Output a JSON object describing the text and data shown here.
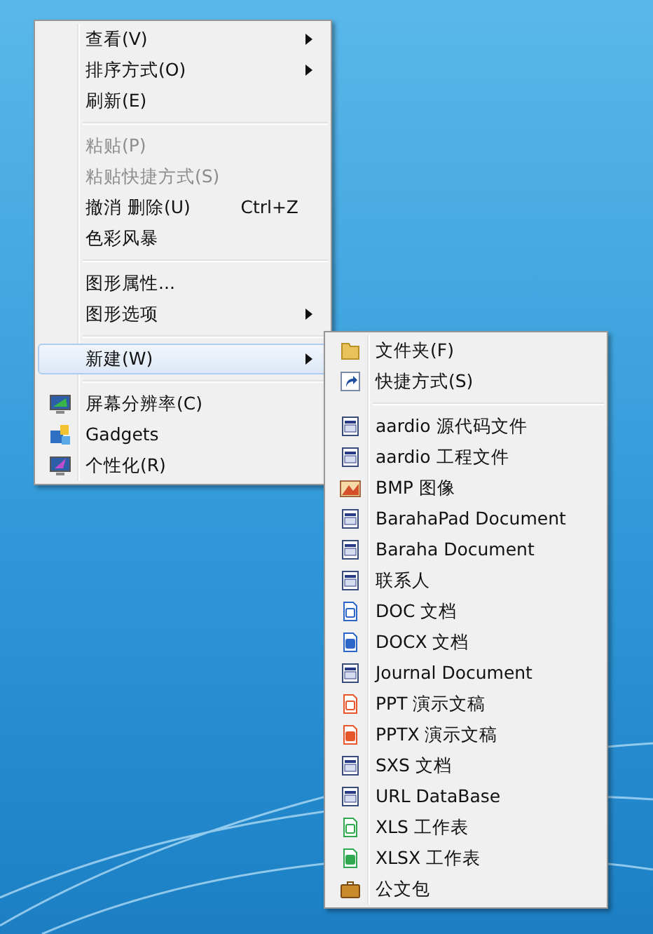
{
  "context_menu": {
    "items": [
      {
        "kind": "submenu",
        "label": "查看(V)",
        "disabled": false,
        "selected": false
      },
      {
        "kind": "submenu",
        "label": "排序方式(O)",
        "disabled": false,
        "selected": false
      },
      {
        "kind": "command",
        "label": "刷新(E)",
        "disabled": false,
        "selected": false
      },
      {
        "kind": "separator"
      },
      {
        "kind": "command",
        "label": "粘贴(P)",
        "disabled": true,
        "selected": false
      },
      {
        "kind": "command",
        "label": "粘贴快捷方式(S)",
        "disabled": true,
        "selected": false
      },
      {
        "kind": "command",
        "label": "撤消 删除(U)",
        "shortcut": "Ctrl+Z",
        "disabled": false,
        "selected": false
      },
      {
        "kind": "command",
        "label": "色彩风暴",
        "disabled": false,
        "selected": false
      },
      {
        "kind": "separator"
      },
      {
        "kind": "command",
        "label": "图形属性...",
        "disabled": false,
        "selected": false
      },
      {
        "kind": "submenu",
        "label": "图形选项",
        "disabled": false,
        "selected": false
      },
      {
        "kind": "separator"
      },
      {
        "kind": "submenu",
        "label": "新建(W)",
        "disabled": false,
        "selected": true
      },
      {
        "kind": "separator"
      },
      {
        "kind": "monitor",
        "label": "屏幕分辨率(C)",
        "disabled": false,
        "selected": false
      },
      {
        "kind": "gadgets",
        "label": "Gadgets",
        "disabled": false,
        "selected": false
      },
      {
        "kind": "personalize",
        "label": "个性化(R)",
        "disabled": false,
        "selected": false
      }
    ]
  },
  "new_submenu": {
    "items": [
      {
        "kind": "folder",
        "label": "文件夹(F)"
      },
      {
        "kind": "shortcut",
        "label": "快捷方式(S)"
      },
      {
        "kind": "separator"
      },
      {
        "kind": "app-file",
        "label": "aardio 源代码文件"
      },
      {
        "kind": "app-file",
        "label": "aardio 工程文件"
      },
      {
        "kind": "image",
        "label": "BMP 图像"
      },
      {
        "kind": "app-file",
        "label": "BarahaPad Document"
      },
      {
        "kind": "app-file",
        "label": "Baraha Document"
      },
      {
        "kind": "app-file",
        "label": "联系人"
      },
      {
        "kind": "word-outline",
        "label": "DOC 文档"
      },
      {
        "kind": "word",
        "label": "DOCX 文档"
      },
      {
        "kind": "app-file",
        "label": "Journal Document"
      },
      {
        "kind": "ppt-outline",
        "label": "PPT 演示文稿"
      },
      {
        "kind": "ppt",
        "label": "PPTX 演示文稿"
      },
      {
        "kind": "app-file",
        "label": "SXS 文档"
      },
      {
        "kind": "app-file",
        "label": "URL DataBase"
      },
      {
        "kind": "sheet-outline",
        "label": "XLS 工作表"
      },
      {
        "kind": "sheet",
        "label": "XLSX 工作表"
      },
      {
        "kind": "briefcase",
        "label": "公文包"
      }
    ]
  }
}
